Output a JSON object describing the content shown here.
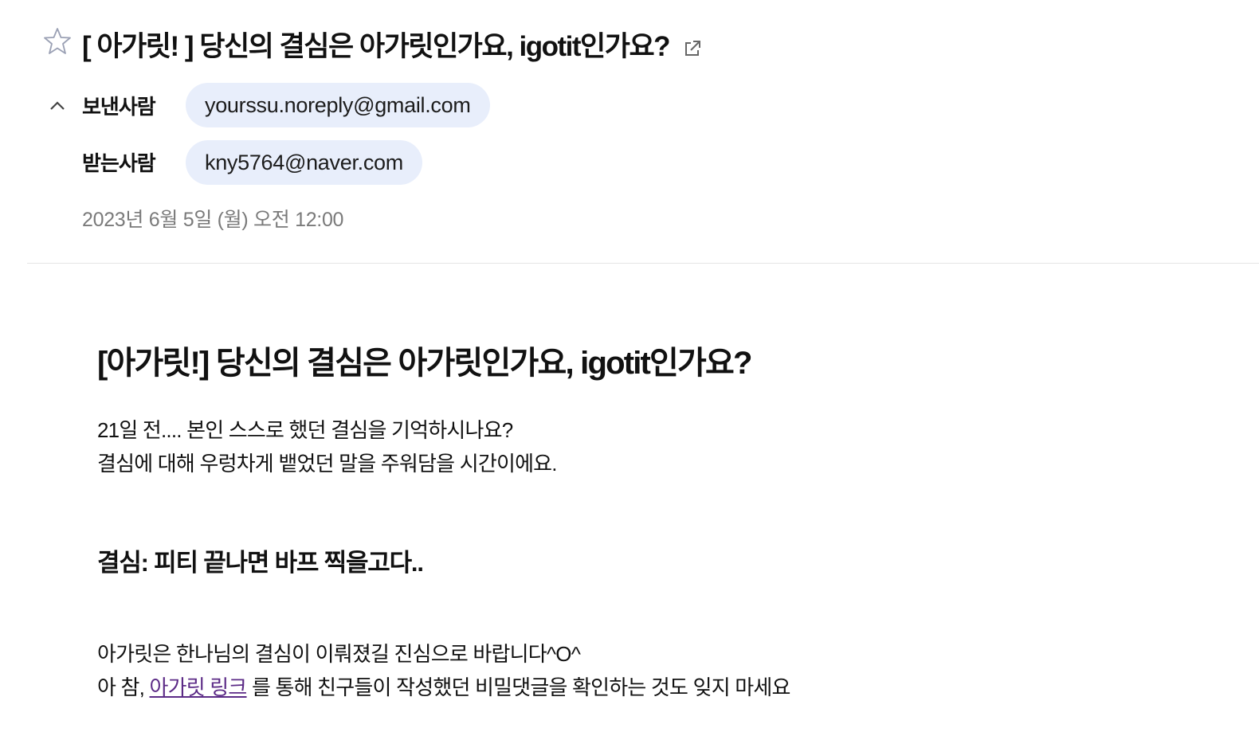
{
  "header": {
    "subject": "[ 아가릿! ] 당신의 결심은 아가릿인가요, igotit인가요?",
    "star_icon": "star-outline-icon",
    "popout_icon": "open-in-new-window-icon",
    "collapse_icon": "chevron-up-icon",
    "sender_label": "보낸사람",
    "sender_email": "yourssu.noreply@gmail.com",
    "recipient_label": "받는사람",
    "recipient_email": "kny5764@naver.com",
    "date": "2023년 6월 5일 (월) 오전 12:00"
  },
  "body": {
    "title": "[아가릿!] 당신의 결심은 아가릿인가요, igotit인가요?",
    "intro_line1": "21일 전.... 본인 스스로 했던 결심을 기억하시나요?",
    "intro_line2": "결심에 대해 우렁차게 뱉었던 말을 주워담을 시간이에요.",
    "resolution": "결심: 피티 끝나면 바프 찍을고다..",
    "outro_line1": "아가릿은 한나님의 결심이 이뤄졌길 진심으로 바랍니다^O^",
    "outro_prefix": "아 참, ",
    "outro_link": "아가릿 링크",
    "outro_suffix": " 를 통해 친구들이 작성했던 비밀댓글을 확인하는 것도 잊지 마세요"
  },
  "colors": {
    "chip_bg": "#e8eefb",
    "link": "#5b2a86",
    "date_text": "#7a7a7a"
  }
}
